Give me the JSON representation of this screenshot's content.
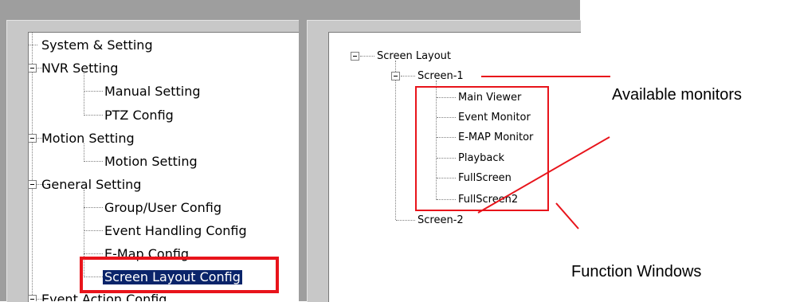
{
  "left_tree": {
    "items": [
      {
        "label": "System & Setting"
      },
      {
        "label": "NVR  Setting"
      },
      {
        "label": "Manual Setting"
      },
      {
        "label": "PTZ Config"
      },
      {
        "label": "Motion Setting"
      },
      {
        "label": "Motion Setting"
      },
      {
        "label": "General Setting"
      },
      {
        "label": "Group/User Config"
      },
      {
        "label": "Event Handling Config"
      },
      {
        "label": "E-Map Config"
      },
      {
        "label": "Screen Layout Config"
      },
      {
        "label": "Event Action Config"
      }
    ],
    "selected_index": 10
  },
  "right_tree": {
    "root": "Screen Layout",
    "screen1": "Screen-1",
    "monitors": [
      "Main Viewer",
      "Event Monitor",
      "E-MAP Monitor",
      "Playback",
      "FullScreen",
      "FullScreen2"
    ],
    "screen2": "Screen-2"
  },
  "annotations": {
    "available_monitors": "Available monitors",
    "function_windows": "Function Windows"
  },
  "colors": {
    "highlight_red": "#e8141b",
    "selection_blue": "#0a246a",
    "frame_gray": "#9e9e9e"
  }
}
